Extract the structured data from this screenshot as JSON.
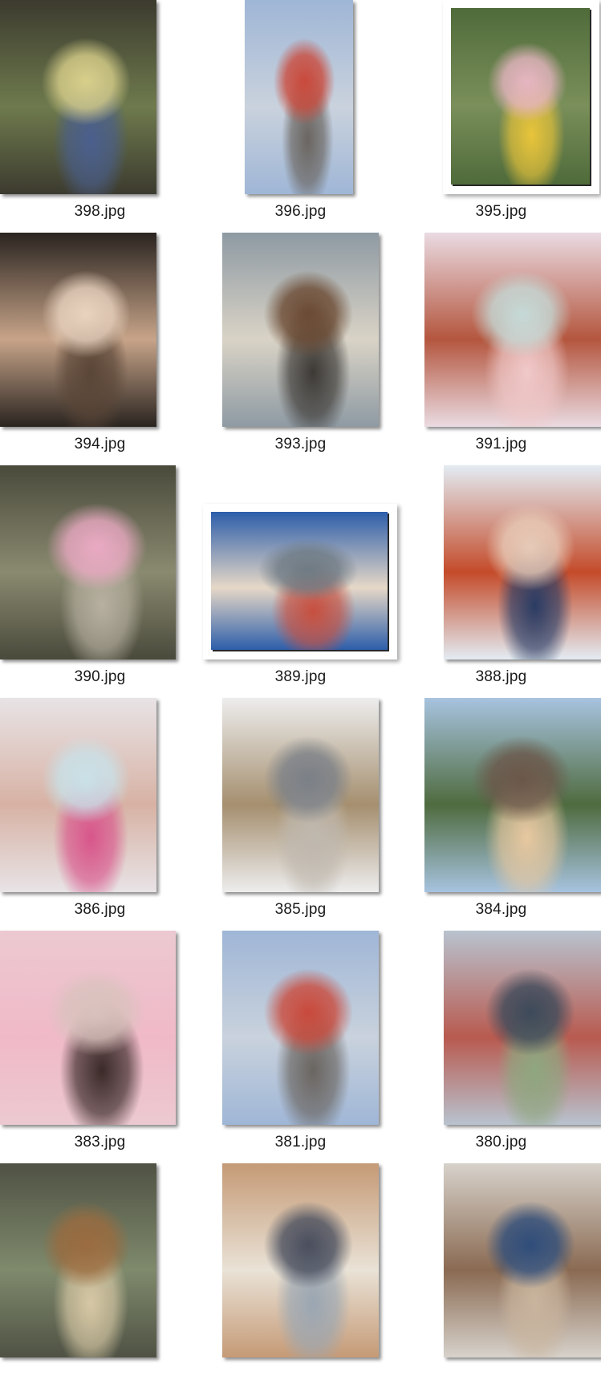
{
  "files": [
    {
      "name": "398.jpg",
      "colors": [
        "#3c3b2f",
        "#6e7a4d",
        "#d8cf8a",
        "#4a5f8e"
      ],
      "orientation": "landscape-square",
      "alt_icon": "photo-icon"
    },
    {
      "name": "396.jpg",
      "colors": [
        "#9fb6d6",
        "#c9d2dd",
        "#c94a3c",
        "#6a6560"
      ],
      "orientation": "portrait",
      "alt_icon": "photo-icon"
    },
    {
      "name": "395.jpg",
      "colors": [
        "#4f6b3a",
        "#7a8f5a",
        "#e6b5c1",
        "#e8c43a"
      ],
      "orientation": "framed",
      "alt_icon": "photo-icon"
    },
    {
      "name": "394.jpg",
      "colors": [
        "#2a2420",
        "#c7a489",
        "#e9d3bf",
        "#5a4637"
      ],
      "orientation": "square",
      "alt_icon": "photo-icon"
    },
    {
      "name": "393.jpg",
      "colors": [
        "#8e9aa3",
        "#d9d3c6",
        "#6b4a33",
        "#3d3a36"
      ],
      "orientation": "portrait",
      "alt_icon": "photo-icon"
    },
    {
      "name": "391.jpg",
      "colors": [
        "#eadbe2",
        "#b4563e",
        "#c5d9d6",
        "#f0c9c9"
      ],
      "orientation": "square",
      "alt_icon": "photo-icon"
    },
    {
      "name": "390.jpg",
      "colors": [
        "#4a4a3c",
        "#8a8a70",
        "#e9a9c2",
        "#b7b0a0"
      ],
      "orientation": "portrait",
      "alt_icon": "photo-icon"
    },
    {
      "name": "389.jpg",
      "colors": [
        "#2d5eaa",
        "#e6d8c7",
        "#6f7b84",
        "#c74f3f"
      ],
      "orientation": "framed",
      "alt_icon": "photo-icon"
    },
    {
      "name": "388.jpg",
      "colors": [
        "#e3ecf3",
        "#c44b2a",
        "#e7cbb8",
        "#2a3c64"
      ],
      "orientation": "portrait",
      "alt_icon": "photo-icon"
    },
    {
      "name": "386.jpg",
      "colors": [
        "#e8e3e6",
        "#d7b2a4",
        "#c9e1e8",
        "#d8568b"
      ],
      "orientation": "portrait",
      "alt_icon": "photo-icon"
    },
    {
      "name": "385.jpg",
      "colors": [
        "#ededed",
        "#a58f6f",
        "#7b8087",
        "#bfb8ae"
      ],
      "orientation": "portrait",
      "alt_icon": "photo-icon"
    },
    {
      "name": "384.jpg",
      "colors": [
        "#a7c3df",
        "#4f6b3f",
        "#6b574a",
        "#e7c8a0"
      ],
      "orientation": "portrait",
      "alt_icon": "photo-icon"
    },
    {
      "name": "383.jpg",
      "colors": [
        "#ecc9d1",
        "#f0b9c8",
        "#d9c2bd",
        "#3a2a28"
      ],
      "orientation": "portrait",
      "alt_icon": "photo-icon"
    },
    {
      "name": "381.jpg",
      "colors": [
        "#9fb6d6",
        "#c9d2dd",
        "#c94a3c",
        "#6a6560"
      ],
      "orientation": "portrait",
      "alt_icon": "photo-icon"
    },
    {
      "name": "380.jpg",
      "colors": [
        "#b8c3cf",
        "#b85a4f",
        "#3d4a5a",
        "#8ea77f"
      ],
      "orientation": "portrait",
      "alt_icon": "photo-icon"
    },
    {
      "name": "",
      "colors": [
        "#4f5244",
        "#7f8a6c",
        "#9a6b3f",
        "#d7c8a5"
      ],
      "orientation": "portrait-cut",
      "alt_icon": "photo-icon"
    },
    {
      "name": "",
      "colors": [
        "#c59a76",
        "#e9e2d6",
        "#4a4f5e",
        "#9aa6b2"
      ],
      "orientation": "portrait-cut",
      "alt_icon": "photo-icon"
    },
    {
      "name": "",
      "colors": [
        "#d7d2cb",
        "#8a6a52",
        "#2f4d7a",
        "#c9b59e"
      ],
      "orientation": "portrait-cut",
      "alt_icon": "photo-icon"
    }
  ]
}
